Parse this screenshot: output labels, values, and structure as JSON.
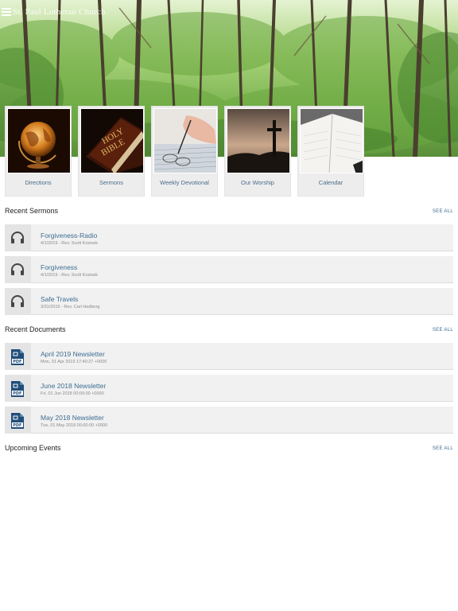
{
  "header": {
    "church_name": "St. Paul Lutheran Church",
    "menu_icon": "hamburger-icon"
  },
  "tiles": [
    {
      "label": "Directions",
      "icon": "globe-image"
    },
    {
      "label": "Sermons",
      "icon": "bible-image"
    },
    {
      "label": "Weekly Devotional",
      "icon": "writing-hand-image"
    },
    {
      "label": "Our Worship",
      "icon": "cross-sunset-image"
    },
    {
      "label": "Calendar",
      "icon": "planner-image"
    }
  ],
  "recent_sermons": {
    "title": "Recent Sermons",
    "see_all": "SEE ALL",
    "items": [
      {
        "title": "Forgiveness-Radio",
        "subtitle": "4/1/2019 - Rev. Scott Kozisek",
        "icon": "headphones-icon"
      },
      {
        "title": "Forgiveness",
        "subtitle": "4/1/2019 - Rev. Scott Kozisek",
        "icon": "headphones-icon"
      },
      {
        "title": "Safe Travels",
        "subtitle": "3/31/2019 - Rev. Carl Hedberg",
        "icon": "headphones-icon"
      }
    ]
  },
  "recent_documents": {
    "title": "Recent Documents",
    "see_all": "SEE ALL",
    "items": [
      {
        "title": "April 2019 Newsletter",
        "subtitle": "Mon, 01 Apr 2019 17:40:27 +0000",
        "icon": "pdf-icon"
      },
      {
        "title": "June 2018 Newsletter",
        "subtitle": "Fri, 01 Jun 2018 00:00:00 +0000",
        "icon": "pdf-icon"
      },
      {
        "title": "May 2018 Newsletter",
        "subtitle": "Tue, 01 May 2018 00:00:00 +0000",
        "icon": "pdf-icon"
      }
    ]
  },
  "upcoming_events": {
    "title": "Upcoming Events",
    "see_all": "SEE ALL"
  },
  "colors": {
    "link": "#3d6d91",
    "row_bg": "#f1f1f1",
    "icon_bg": "#e4e4e4",
    "pdf_blue": "#1f4e79"
  }
}
